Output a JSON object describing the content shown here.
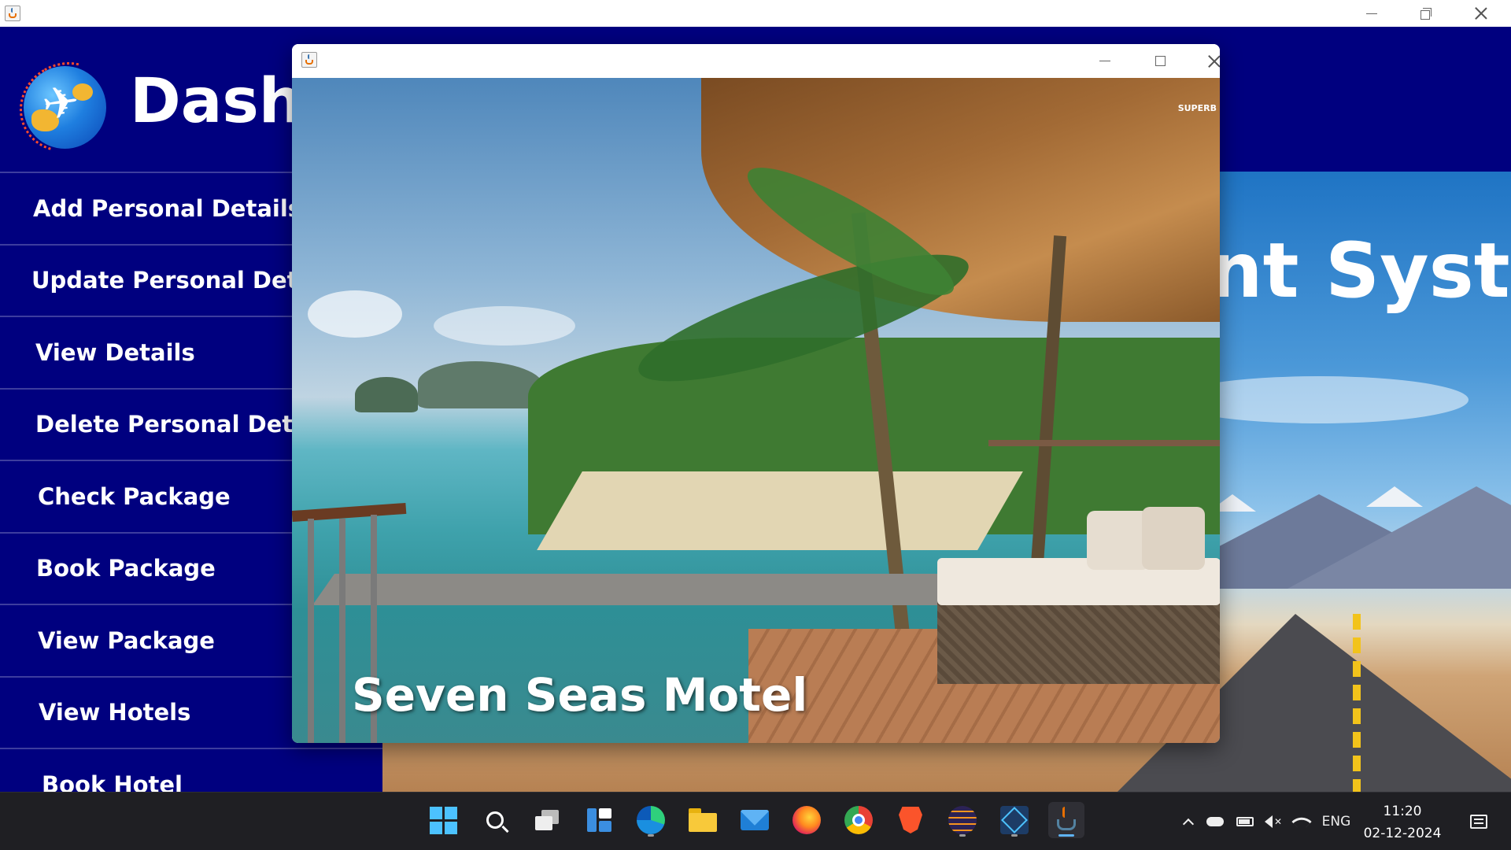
{
  "dashboard": {
    "heading": "Dashboard",
    "hero_title": "Tourism Management System"
  },
  "menu": {
    "items": [
      {
        "label": "Add Personal Details"
      },
      {
        "label": "Update Personal Details"
      },
      {
        "label": "View Details"
      },
      {
        "label": "Delete Personal Details"
      },
      {
        "label": "Check Package"
      },
      {
        "label": "Book Package"
      },
      {
        "label": "View Package"
      },
      {
        "label": "View Hotels"
      },
      {
        "label": "Book Hotel"
      }
    ]
  },
  "popup": {
    "hotel_name": "Seven Seas Motel",
    "watermark": "SUPERB"
  },
  "taskbar": {
    "apps": [
      {
        "icon": "windows-start-icon"
      },
      {
        "icon": "search-icon"
      },
      {
        "icon": "task-view-icon"
      },
      {
        "icon": "widgets-icon"
      },
      {
        "icon": "edge-icon"
      },
      {
        "icon": "file-explorer-icon"
      },
      {
        "icon": "mail-icon"
      },
      {
        "icon": "firefox-icon"
      },
      {
        "icon": "chrome-icon"
      },
      {
        "icon": "brave-icon"
      },
      {
        "icon": "eclipse-icon"
      },
      {
        "icon": "app-icon"
      },
      {
        "icon": "java-icon"
      }
    ],
    "tray": {
      "language": "ENG",
      "time": "11:20",
      "date": "02-12-2024"
    }
  },
  "colors": {
    "menu_bg": "#00007f",
    "taskbar_bg": "#1f1f23",
    "accent": "#5fb3f5"
  }
}
